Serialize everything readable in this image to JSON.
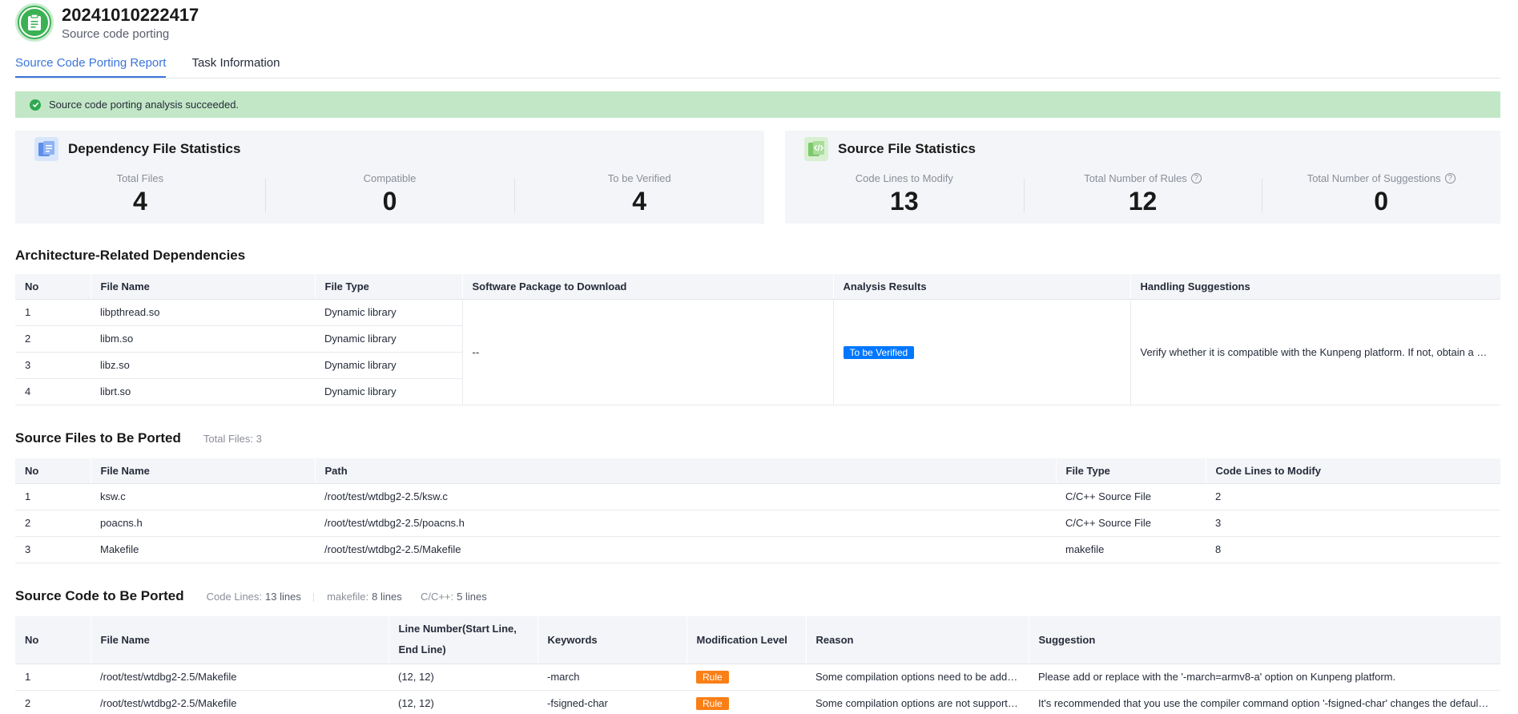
{
  "header": {
    "title": "20241010222417",
    "subtitle": "Source code porting"
  },
  "tabs": [
    {
      "label": "Source Code Porting Report",
      "active": true
    },
    {
      "label": "Task Information",
      "active": false
    }
  ],
  "banner": {
    "text": "Source code porting analysis succeeded."
  },
  "dependency_stats": {
    "title": "Dependency File Statistics",
    "items": [
      {
        "label": "Total Files",
        "value": "4"
      },
      {
        "label": "Compatible",
        "value": "0"
      },
      {
        "label": "To be Verified",
        "value": "4"
      }
    ]
  },
  "source_stats": {
    "title": "Source File Statistics",
    "items": [
      {
        "label": "Code Lines to Modify",
        "value": "13"
      },
      {
        "label": "Total Number of Rules",
        "value": "12"
      },
      {
        "label": "Total Number of Suggestions",
        "value": "0"
      }
    ]
  },
  "arch_deps": {
    "title": "Architecture-Related Dependencies",
    "columns": [
      "No",
      "File Name",
      "File Type",
      "Software Package to Download",
      "Analysis Results",
      "Handling Suggestions"
    ],
    "rows": [
      {
        "no": "1",
        "name": "libpthread.so",
        "type": "Dynamic library"
      },
      {
        "no": "2",
        "name": "libm.so",
        "type": "Dynamic library"
      },
      {
        "no": "3",
        "name": "libz.so",
        "type": "Dynamic library"
      },
      {
        "no": "4",
        "name": "librt.so",
        "type": "Dynamic library"
      }
    ],
    "package": "--",
    "result": "To be Verified",
    "suggestion": "Verify whether it is compatible with the Kunpeng platform. If not, obtain a K..."
  },
  "source_files": {
    "title": "Source Files to Be Ported",
    "total_label": "Total Files: 3",
    "columns": [
      "No",
      "File Name",
      "Path",
      "File Type",
      "Code Lines to Modify"
    ],
    "rows": [
      {
        "no": "1",
        "name": "ksw.c",
        "path": "/root/test/wtdbg2-2.5/ksw.c",
        "type": "C/C++ Source File",
        "lines": "2"
      },
      {
        "no": "2",
        "name": "poacns.h",
        "path": "/root/test/wtdbg2-2.5/poacns.h",
        "type": "C/C++ Source File",
        "lines": "3"
      },
      {
        "no": "3",
        "name": "Makefile",
        "path": "/root/test/wtdbg2-2.5/Makefile",
        "type": "makefile",
        "lines": "8"
      }
    ]
  },
  "source_code": {
    "title": "Source Code to Be Ported",
    "code_lines_label": "Code Lines:",
    "code_lines_value": "13 lines",
    "makefile_label": "makefile:",
    "makefile_value": "8 lines",
    "cpp_label": "C/C++:",
    "cpp_value": "5 lines",
    "columns": [
      "No",
      "File Name",
      "Line Number(Start Line, End Line)",
      "Keywords",
      "Modification Level",
      "Reason",
      "Suggestion"
    ],
    "rows": [
      {
        "no": "1",
        "file": "/root/test/wtdbg2-2.5/Makefile",
        "line": "(12, 12)",
        "keyword": "-march",
        "level": "Rule",
        "reason": "Some compilation options need to be adde...",
        "suggestion": "Please add or replace with the '-march=armv8-a' option on Kunpeng platform."
      },
      {
        "no": "2",
        "file": "/root/test/wtdbg2-2.5/Makefile",
        "line": "(12, 12)",
        "keyword": "-fsigned-char",
        "level": "Rule",
        "reason": "Some compilation options are not supporte...",
        "suggestion": "It's recommended that you use the compiler command option '-fsigned-char' changes the default ..."
      }
    ]
  }
}
